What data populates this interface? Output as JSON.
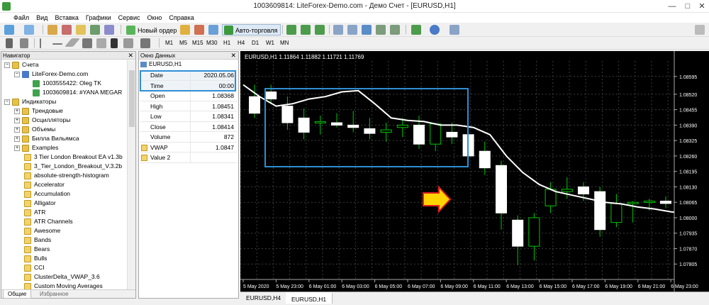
{
  "window": {
    "title": "1003609814: LiteForex-Demo.com - Демо Счет - [EURUSD,H1]"
  },
  "menu": [
    "Файл",
    "Вид",
    "Вставка",
    "Графики",
    "Сервис",
    "Окно",
    "Справка"
  ],
  "toolbar": {
    "new_order_label": "Новый ордер",
    "autotrade_label": "Авто-торговля",
    "timeframes": [
      "M1",
      "M5",
      "M15",
      "M30",
      "H1",
      "H4",
      "D1",
      "W1",
      "MN"
    ]
  },
  "navigator": {
    "title": "Навигатор",
    "accounts_label": "Счета",
    "server_label": "LiteForex-Demo.com",
    "account_1": "1003555422: Oleg TK",
    "account_2": "1003609814: #YANA MEGAR",
    "indicators_label": "Индикаторы",
    "folders": [
      "Трендовые",
      "Осцилляторы",
      "Объемы",
      "Билла Вильямса",
      "Examples"
    ],
    "items": [
      "3 Tier London Breakout EA v1.3b",
      "3_Tier_London_Breakout_V.3.2b",
      "absolute-strength-histogram",
      "Accelerator",
      "Accumulation",
      "Alligator",
      "ATR",
      "ATR Channels",
      "Awesome",
      "Bands",
      "Bears",
      "Bulls",
      "CCI",
      "ClusterDelta_VWAP_3.6",
      "Custom Moving Averages"
    ],
    "tabs": [
      "Общие",
      "Избранное"
    ]
  },
  "data_window": {
    "title": "Окно Данных",
    "symbol": "EURUSD,H1",
    "rows": [
      {
        "label": "Date",
        "value": "2020.05.06"
      },
      {
        "label": "Time",
        "value": "00:00"
      },
      {
        "label": "Open",
        "value": "1.08368"
      },
      {
        "label": "High",
        "value": "1.08451"
      },
      {
        "label": "Low",
        "value": "1.08341"
      },
      {
        "label": "Close",
        "value": "1.08414"
      },
      {
        "label": "Volume",
        "value": "872"
      },
      {
        "label": "VWAP",
        "value": "1.0847"
      },
      {
        "label": "Value 2",
        "value": ""
      }
    ]
  },
  "chart": {
    "header": "EURUSD,H1  1.11864  1.11882  1.11721  1.11769",
    "price_labels": [
      "1.08595",
      "1.08520",
      "1.08455",
      "1.08390",
      "1.08325",
      "1.08260",
      "1.08195",
      "1.08130",
      "1.08065",
      "1.08000",
      "1.07935",
      "1.07870",
      "1.07805"
    ],
    "time_labels": [
      "5 May 2020",
      "5 May 23:00",
      "6 May 01:00",
      "6 May 03:00",
      "6 May 05:00",
      "6 May 07:00",
      "6 May 09:00",
      "6 May 11:00",
      "6 May 13:00",
      "6 May 15:00",
      "6 May 17:00",
      "6 May 19:00",
      "6 May 21:00",
      "6 May 23:00"
    ],
    "tabs": [
      "EURUSD,H4",
      "EURUSD,H1"
    ],
    "colors": {
      "background": "#000000",
      "grid": "#3c3c3c",
      "candle_up": "#ffffff",
      "candle_down": "#ffffff",
      "wick": "#00c800",
      "vwap": "#ffffff",
      "box": "#2e8ed4",
      "arrow_fill": "#ffd400",
      "arrow_stroke": "#e02020"
    },
    "ylim": [
      1.0774,
      1.0866
    ]
  },
  "chart_data": {
    "type": "candlestick",
    "series": [
      {
        "name": "EURUSD,H1",
        "ohlc": [
          [
            1.0851,
            1.0856,
            1.0842,
            1.0844
          ],
          [
            1.0853,
            1.0856,
            1.0848,
            1.085
          ],
          [
            1.0847,
            1.0851,
            1.0837,
            1.084
          ],
          [
            1.0842,
            1.0846,
            1.0833,
            1.0836
          ],
          [
            1.084,
            1.0843,
            1.0835,
            1.08405
          ],
          [
            1.084,
            1.0844,
            1.0838,
            1.0839
          ],
          [
            1.0839,
            1.0845,
            1.0836,
            1.0838
          ],
          [
            1.08375,
            1.0842,
            1.0833,
            1.08355
          ],
          [
            1.0836,
            1.084,
            1.0832,
            1.0837
          ],
          [
            1.0838,
            1.0842,
            1.0834,
            1.0839
          ],
          [
            1.0839,
            1.0843,
            1.0829,
            1.0831
          ],
          [
            1.0831,
            1.084,
            1.0828,
            1.08395
          ],
          [
            1.0836,
            1.084,
            1.0831,
            1.0834
          ],
          [
            1.0835,
            1.0838,
            1.0823,
            1.0826
          ],
          [
            1.0828,
            1.0832,
            1.0818,
            1.0821
          ],
          [
            1.0822,
            1.0824,
            1.0795,
            1.0802
          ],
          [
            1.0799,
            1.0801,
            1.078,
            1.0788
          ],
          [
            1.0788,
            1.0802,
            1.0782,
            1.08
          ],
          [
            1.0805,
            1.0815,
            1.0802,
            1.0812
          ],
          [
            1.0811,
            1.0817,
            1.0808,
            1.0812
          ],
          [
            1.0813,
            1.0815,
            1.0807,
            1.081
          ],
          [
            1.0811,
            1.0813,
            1.0792,
            1.0795
          ],
          [
            1.0798,
            1.081,
            1.0796,
            1.0806
          ],
          [
            1.0806,
            1.0807,
            1.0798,
            1.08065
          ],
          [
            1.08065,
            1.0808,
            1.0803,
            1.0807
          ],
          [
            1.0807,
            1.0809,
            1.0804,
            1.0806
          ],
          [
            1.0808,
            1.0809,
            1.0801,
            1.0803
          ],
          [
            1.0802,
            1.0803,
            1.0793,
            1.07935
          ],
          [
            1.0793,
            1.0794,
            1.07925,
            1.07935
          ]
        ]
      },
      {
        "name": "VWAP",
        "values": [
          1.0856,
          1.0851,
          1.0847,
          1.0848,
          1.085,
          1.0851,
          1.0853,
          1.08535,
          1.0848,
          1.0842,
          1.0841,
          1.08405,
          1.0839,
          1.0839,
          1.0838,
          1.0835,
          1.0826,
          1.0819,
          1.0814,
          1.0811,
          1.08095,
          1.0808,
          1.08065,
          1.08058,
          1.08045,
          1.08037,
          1.08025,
          1.08018,
          1.08012,
          1.0801
        ]
      }
    ]
  }
}
